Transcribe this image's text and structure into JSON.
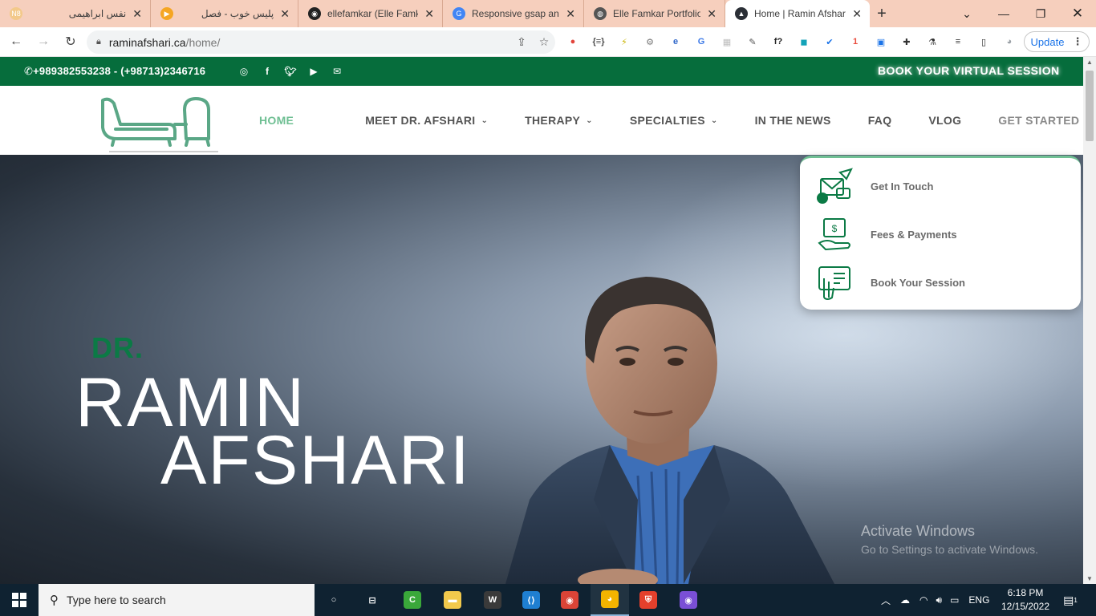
{
  "browser": {
    "tabs": [
      {
        "title": "نفس ابراهیمی",
        "fav_text": "N8",
        "fav_color": "#f3c98a",
        "rtl": true
      },
      {
        "title": "پلیس خوب - فصل",
        "fav_text": "▶",
        "fav_color": "#f5a623",
        "rtl": true
      },
      {
        "title": "ellefamkar (Elle Famkar)",
        "fav_text": "◉",
        "fav_color": "#222222",
        "rtl": false
      },
      {
        "title": "Responsive gsap animation",
        "fav_text": "G",
        "fav_color": "#4285f4",
        "rtl": false
      },
      {
        "title": "Elle Famkar Portfolio | Front",
        "fav_text": "◍",
        "fav_color": "#555555",
        "rtl": false
      },
      {
        "title": "Home | Ramin Afshari",
        "fav_text": "▲",
        "fav_color": "#2b2f36",
        "rtl": false
      }
    ],
    "url_domain": "raminafshari.ca",
    "url_path": "/home/",
    "update_label": "Update",
    "extensions": [
      {
        "name": "color-wheel-icon",
        "glyph": "●",
        "color": "#e2453c"
      },
      {
        "name": "json-icon",
        "glyph": "{≡}",
        "color": "#4a4a4a"
      },
      {
        "name": "bolt-icon",
        "glyph": "⚡",
        "color": "#c9b400"
      },
      {
        "name": "gear-ext-icon",
        "glyph": "⚙",
        "color": "#777777"
      },
      {
        "name": "edge-ext-icon",
        "glyph": "e",
        "color": "#2f66c9"
      },
      {
        "name": "translate-icon",
        "glyph": "G",
        "color": "#3b78e7"
      },
      {
        "name": "grid-ext-icon",
        "glyph": "▦",
        "color": "#bdbdbd"
      },
      {
        "name": "picker-icon",
        "glyph": "✎",
        "color": "#555555"
      },
      {
        "name": "font-ext-icon",
        "glyph": "f?",
        "color": "#222222"
      },
      {
        "name": "square-ext-icon",
        "glyph": "◼",
        "color": "#14a3b8"
      },
      {
        "name": "check-ext-icon",
        "glyph": "✔",
        "color": "#1a73e8"
      },
      {
        "name": "badge-ext-icon",
        "glyph": "1",
        "color": "#e94b3c"
      },
      {
        "name": "screen-ext-icon",
        "glyph": "▣",
        "color": "#1a73e8"
      },
      {
        "name": "puzzle-icon",
        "glyph": "✚",
        "color": "#333333"
      },
      {
        "name": "flask-icon",
        "glyph": "⚗",
        "color": "#333333"
      },
      {
        "name": "playlist-icon",
        "glyph": "≡",
        "color": "#333333"
      },
      {
        "name": "sidepanel-icon",
        "glyph": "▯",
        "color": "#222222"
      },
      {
        "name": "profile-icon",
        "glyph": "◕",
        "color": "#9aa0a6"
      }
    ]
  },
  "site": {
    "phone": "+989382553238 - (+98713)2346716",
    "book_virtual": "BOOK YOUR VIRTUAL SESSION",
    "social": [
      "instagram-icon",
      "facebook-icon",
      "twitter-icon",
      "youtube-icon",
      "mail-icon"
    ],
    "nav": [
      {
        "label": "HOME",
        "caret": false,
        "state": "active"
      },
      {
        "label": "MEET DR. AFSHARI",
        "caret": true,
        "state": ""
      },
      {
        "label": "THERAPY",
        "caret": true,
        "state": ""
      },
      {
        "label": "SPECIALTIES",
        "caret": true,
        "state": ""
      },
      {
        "label": "IN THE NEWS",
        "caret": false,
        "state": ""
      },
      {
        "label": "FAQ",
        "caret": false,
        "state": ""
      },
      {
        "label": "VLOG",
        "caret": false,
        "state": ""
      },
      {
        "label": "GET STARTED",
        "caret": true,
        "state": "muted"
      }
    ],
    "dropdown": [
      {
        "label": "Get In Touch",
        "icon": "contact-envelope-icon"
      },
      {
        "label": "Fees & Payments",
        "icon": "money-hand-icon"
      },
      {
        "label": "Book Your Session",
        "icon": "booking-phone-icon"
      }
    ],
    "hero": {
      "prefix": "DR.",
      "first_name": "RAMIN",
      "last_name": "AFSHARI"
    },
    "watermark": {
      "line1": "Activate Windows",
      "line2": "Go to Settings to activate Windows."
    },
    "colors": {
      "brand_green": "#066d3c",
      "accent_green": "#6fbf93"
    }
  },
  "taskbar": {
    "search_placeholder": "Type here to search",
    "apps": [
      {
        "name": "cortana-icon",
        "glyph": "○",
        "color": "transparent"
      },
      {
        "name": "task-view-icon",
        "glyph": "⊟",
        "color": "transparent"
      },
      {
        "name": "camtasia-icon",
        "glyph": "C",
        "color": "#3aa83a"
      },
      {
        "name": "file-explorer-icon",
        "glyph": "▬",
        "color": "#f2c94c"
      },
      {
        "name": "wamp-icon",
        "glyph": "W",
        "color": "#3a3a3a"
      },
      {
        "name": "vscode-icon",
        "glyph": "⟨⟩",
        "color": "#1f7fd1"
      },
      {
        "name": "chrome-icon",
        "glyph": "◉",
        "color": "#db4437"
      },
      {
        "name": "chrome-profile-icon",
        "glyph": "◕",
        "color": "#f4b400"
      },
      {
        "name": "brave-icon",
        "glyph": "⛨",
        "color": "#e4402c"
      },
      {
        "name": "github-desktop-icon",
        "glyph": "◉",
        "color": "#7a4fd6"
      }
    ],
    "lang": "ENG",
    "time": "6:18 PM",
    "date": "12/15/2022",
    "notif_count": "1"
  }
}
